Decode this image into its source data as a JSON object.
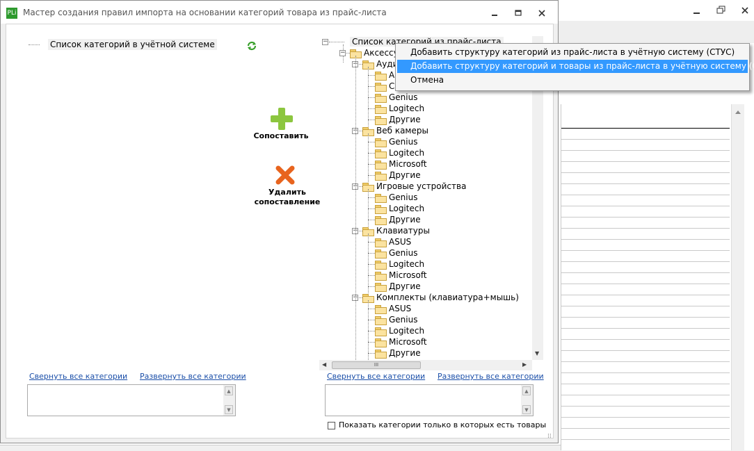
{
  "dialog": {
    "app_icon_text": "PLi",
    "title": "Мастер создания правил импорта на основании категорий товара из прайс-листа",
    "minimize": "▭",
    "maximize": "▣",
    "close": "✕"
  },
  "left_panel": {
    "header": "Список категорий в учётной системе",
    "collapse_link": "Свернуть все категории",
    "expand_link": "Развернуть все категории"
  },
  "actions": {
    "match_label": "Сопоставить",
    "unmatch_label": "Удалить сопоставление"
  },
  "right_panel": {
    "header": "Список категорий из прайс-листа",
    "collapse_link": "Свернуть все категории",
    "expand_link": "Развернуть все категории",
    "checkbox_label": "Показать категории только в которых есть товары",
    "tree": {
      "root": "Аксессуары",
      "groups": [
        {
          "name": "Аудио",
          "children": [
            "ASUS",
            "Creative",
            "Genius",
            "Logitech",
            "Другие"
          ]
        },
        {
          "name": "Веб камеры",
          "children": [
            "Genius",
            "Logitech",
            "Microsoft",
            "Другие"
          ]
        },
        {
          "name": "Игровые устройства",
          "children": [
            "Genius",
            "Logitech",
            "Другие"
          ]
        },
        {
          "name": "Клавиатуры",
          "children": [
            "ASUS",
            "Genius",
            "Logitech",
            "Microsoft",
            "Другие"
          ]
        },
        {
          "name": "Комплекты (клавиатура+мышь)",
          "children": [
            "ASUS",
            "Genius",
            "Logitech",
            "Microsoft",
            "Другие"
          ]
        }
      ]
    }
  },
  "context_menu": {
    "items": [
      {
        "label": "Добавить структуру категорий из прайс-листа в учётную систему (СТУС)",
        "active": false
      },
      {
        "label": "Добавить структуру категорий и товары из прайс-листа в учётную систему (СТУС)",
        "active": true
      },
      {
        "label": "Отмена",
        "active": false
      }
    ]
  },
  "colors": {
    "menu_highlight": "#3399ff",
    "link": "#1a4ea8",
    "plus_green": "#8cc63f",
    "delete_orange": "#e8641e"
  }
}
